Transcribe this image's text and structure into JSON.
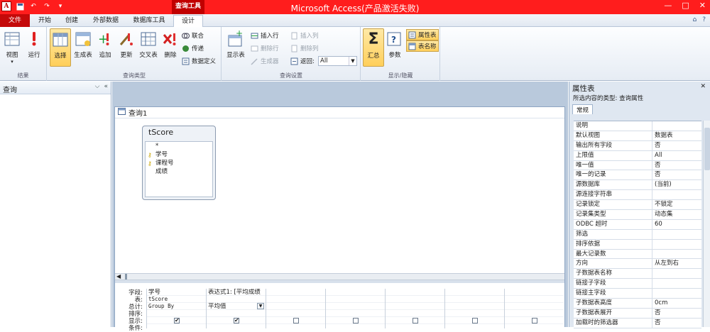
{
  "title_bar": {
    "app_badge": "A",
    "context_tab": "查询工具",
    "window_title": "Microsoft Access(产品激活失败)",
    "controls": [
      "—",
      "□",
      "✕"
    ]
  },
  "tabs": [
    "文件",
    "开始",
    "创建",
    "外部数据",
    "数据库工具",
    "设计"
  ],
  "tab_right_icons": [
    "⌂",
    "?"
  ],
  "ribbon": {
    "results": {
      "label": "结果",
      "view": "视图",
      "run": "运行"
    },
    "query_type": {
      "label": "查询类型",
      "select": "选择",
      "make_table": "生成表",
      "append": "追加",
      "update": "更新",
      "crosstab": "交叉表",
      "delete": "删除",
      "union": "联合",
      "passthrough": "传递",
      "data_def": "数据定义"
    },
    "query_setup": {
      "label": "查询设置",
      "show_table": "显示表",
      "insert_row": "插入行",
      "delete_row": "删除行",
      "builder": "生成器",
      "insert_col": "插入列",
      "delete_col": "删除列",
      "return_label": "返回:",
      "return_value": "All"
    },
    "show_hide": {
      "label": "显示/隐藏",
      "totals": "汇总",
      "parameters": "参数",
      "property_sheet": "属性表",
      "table_names": "表名称"
    }
  },
  "nav_pane": {
    "title": "查询"
  },
  "query_window": {
    "title": "查询1",
    "table": {
      "name": "tScore",
      "fields": [
        {
          "name": "*",
          "key": false
        },
        {
          "name": "学号",
          "key": true
        },
        {
          "name": "课程号",
          "key": true
        },
        {
          "name": "成绩",
          "key": false
        }
      ]
    },
    "row_labels": [
      "字段:",
      "表:",
      "总计:",
      "排序:",
      "显示:",
      "条件:"
    ],
    "columns": [
      {
        "field": "学号",
        "table": "tScore",
        "total": "Group By",
        "show": "✔"
      },
      {
        "field": "表达式1: [平均成绩",
        "table": "",
        "total": "平均值",
        "show": "✔"
      },
      {
        "field": "",
        "table": "",
        "total": "",
        "show": ""
      },
      {
        "field": "",
        "table": "",
        "total": "",
        "show": ""
      },
      {
        "field": "",
        "table": "",
        "total": "",
        "show": ""
      },
      {
        "field": "",
        "table": "",
        "total": "",
        "show": ""
      },
      {
        "field": "",
        "table": "",
        "total": "",
        "show": ""
      }
    ]
  },
  "property_sheet": {
    "title": "属性表",
    "selection_type": "所选内容的类型: 查询属性",
    "tab": "常规",
    "rows": [
      {
        "k": "说明",
        "v": ""
      },
      {
        "k": "默认视图",
        "v": "数据表"
      },
      {
        "k": "输出所有字段",
        "v": "否"
      },
      {
        "k": "上限值",
        "v": "All"
      },
      {
        "k": "唯一值",
        "v": "否"
      },
      {
        "k": "唯一的记录",
        "v": "否"
      },
      {
        "k": "源数据库",
        "v": "(当前)"
      },
      {
        "k": "源连接字符串",
        "v": ""
      },
      {
        "k": "记录锁定",
        "v": "不锁定"
      },
      {
        "k": "记录集类型",
        "v": "动态集"
      },
      {
        "k": "ODBC 超时",
        "v": "60"
      },
      {
        "k": "筛选",
        "v": ""
      },
      {
        "k": "排序依据",
        "v": ""
      },
      {
        "k": "最大记录数",
        "v": ""
      },
      {
        "k": "方向",
        "v": "从左到右"
      },
      {
        "k": "子数据表名称",
        "v": ""
      },
      {
        "k": "链接子字段",
        "v": ""
      },
      {
        "k": "链接主字段",
        "v": ""
      },
      {
        "k": "子数据表高度",
        "v": "0cm"
      },
      {
        "k": "子数据表展开",
        "v": "否"
      },
      {
        "k": "加载时的筛选器",
        "v": "否"
      }
    ]
  }
}
